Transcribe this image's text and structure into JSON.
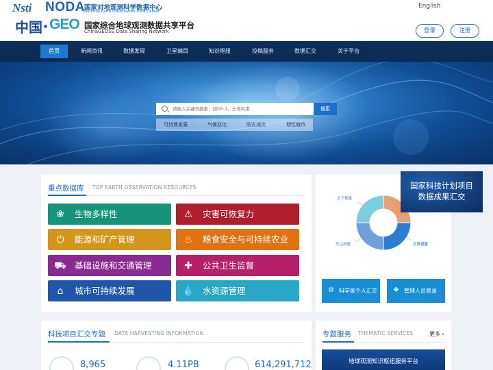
{
  "header": {
    "nsti_logo": "Nsti",
    "noda_logo": "NODA",
    "noda_title_cn": "国家对地观测科学数据中心",
    "noda_title_en": "National Earth Observation Data Center",
    "china_logo": "中国",
    "geo_logo": "GEO",
    "geo_title_cn": "国家综合地球观测数据共享平台",
    "geo_title_en": "ChinaGEOSS Data Sharing Network",
    "language": "English",
    "login": "登录",
    "register": "注册"
  },
  "nav": {
    "items": [
      "首页",
      "新闻资讯",
      "数据发现",
      "卫星编目",
      "知识枢纽",
      "投稿服务",
      "数据汇交",
      "关于平台"
    ],
    "active_index": 0
  },
  "search": {
    "placeholder": "请输入关键词搜索，如GF-1，土地利用",
    "button": "搜索",
    "tags": [
      "可持续发展",
      "气候变化",
      "防灾减灾",
      "韧性城市"
    ]
  },
  "resources": {
    "title": "重点数据库",
    "subtitle": "TOP EARTH OBSERVATION RESOURCES",
    "tiles": [
      {
        "label": "生物多样性",
        "color": "#17957a",
        "icon": "biodiversity-icon",
        "glyph": "❀"
      },
      {
        "label": "灾害可恢复力",
        "color": "#b01e2c",
        "icon": "warning-icon",
        "glyph": "⚠"
      },
      {
        "label": "能源和矿产管理",
        "color": "#d4961a",
        "icon": "power-icon",
        "glyph": "⏻"
      },
      {
        "label": "粮食安全与可持续农业",
        "color": "#e0720f",
        "icon": "food-bowl-icon",
        "glyph": "♨"
      },
      {
        "label": "基础设施和交通管理",
        "color": "#8a2b94",
        "icon": "truck-icon",
        "glyph": "⛟"
      },
      {
        "label": "公共卫生监督",
        "color": "#b81f6b",
        "icon": "medical-icon",
        "glyph": "✚"
      },
      {
        "label": "城市可持续发展",
        "color": "#1f56a8",
        "icon": "home-icon",
        "glyph": "⌂"
      },
      {
        "label": "水资源管理",
        "color": "#2aa7c7",
        "icon": "water-drop-icon",
        "glyph": "💧"
      }
    ]
  },
  "donut": {
    "labels": [
      "总下载量",
      "总数据量",
      "总注册量"
    ],
    "colors": [
      "#e8a072",
      "#2a7fd4",
      "#6fa0dc",
      "#7ccde0"
    ]
  },
  "promo": {
    "line1": "国家科技计划项目",
    "line2": "数据成果汇交"
  },
  "side_buttons": {
    "scientist": "科学家个人汇交",
    "admin": "管理人员登录"
  },
  "harvest": {
    "title": "科技项目汇交专题",
    "subtitle": "DATA HARVESTING INFORMATION",
    "stats": [
      "8,965",
      "4.11PB",
      "614,291,712"
    ]
  },
  "thematic": {
    "title": "专题服务",
    "subtitle": "THEMATIC SERVICES",
    "more": "更多",
    "card": "地球观测知识枢纽服务平台"
  }
}
